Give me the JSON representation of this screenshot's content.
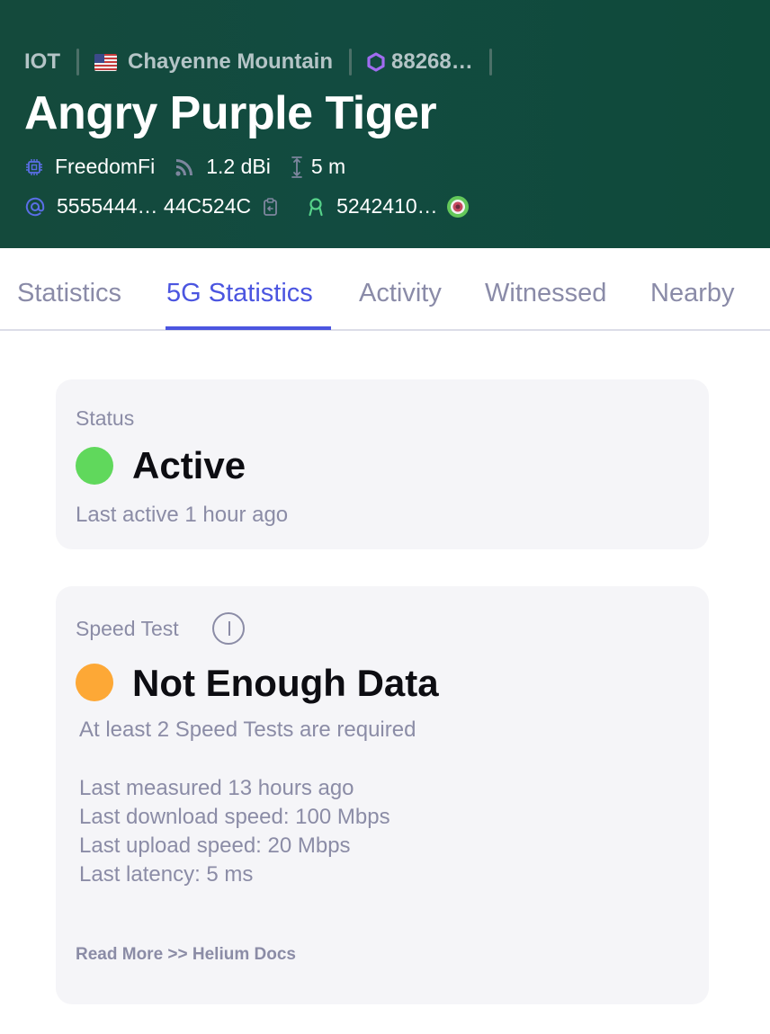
{
  "header": {
    "breadcrumbs": {
      "network": "IOT",
      "location": "Chayenne Mountain",
      "hex": "88268…"
    },
    "title": "Angry Purple Tiger",
    "maker": "FreedomFi",
    "antenna_gain": "1.2 dBi",
    "elevation": "5 m",
    "address": "5555444… 44C524C",
    "owner": "5242410…",
    "icons": {
      "location": "us-flag-icon",
      "hex": "hexagon-icon",
      "maker": "chip-icon",
      "antenna": "signal-icon",
      "elevation": "elevation-icon",
      "address": "at-icon",
      "copy": "copy-icon",
      "owner": "user-icon",
      "owner_avatar": "target-avatar-icon"
    }
  },
  "tabs": [
    {
      "label": "Statistics",
      "active": false
    },
    {
      "label": "5G Statistics",
      "active": true
    },
    {
      "label": "Activity",
      "active": false
    },
    {
      "label": "Witnessed",
      "active": false
    },
    {
      "label": "Nearby",
      "active": false
    }
  ],
  "status_card": {
    "label": "Status",
    "value": "Active",
    "subtext": "Last active 1 hour ago",
    "color": "#60d85c"
  },
  "speed_card": {
    "label": "Speed Test",
    "value": "Not Enough Data",
    "subtext": "At least 2 Speed Tests are required",
    "details": [
      "Last measured 13 hours ago",
      "Last download speed: 100 Mbps",
      "Last upload speed: 20 Mbps",
      "Last latency: 5 ms"
    ],
    "read_more": "Read More >> Helium Docs",
    "color": "#fda836"
  },
  "colors": {
    "header_bg": "#134a3c",
    "accent": "#4b55e0",
    "muted_text": "#8b8ca6"
  }
}
